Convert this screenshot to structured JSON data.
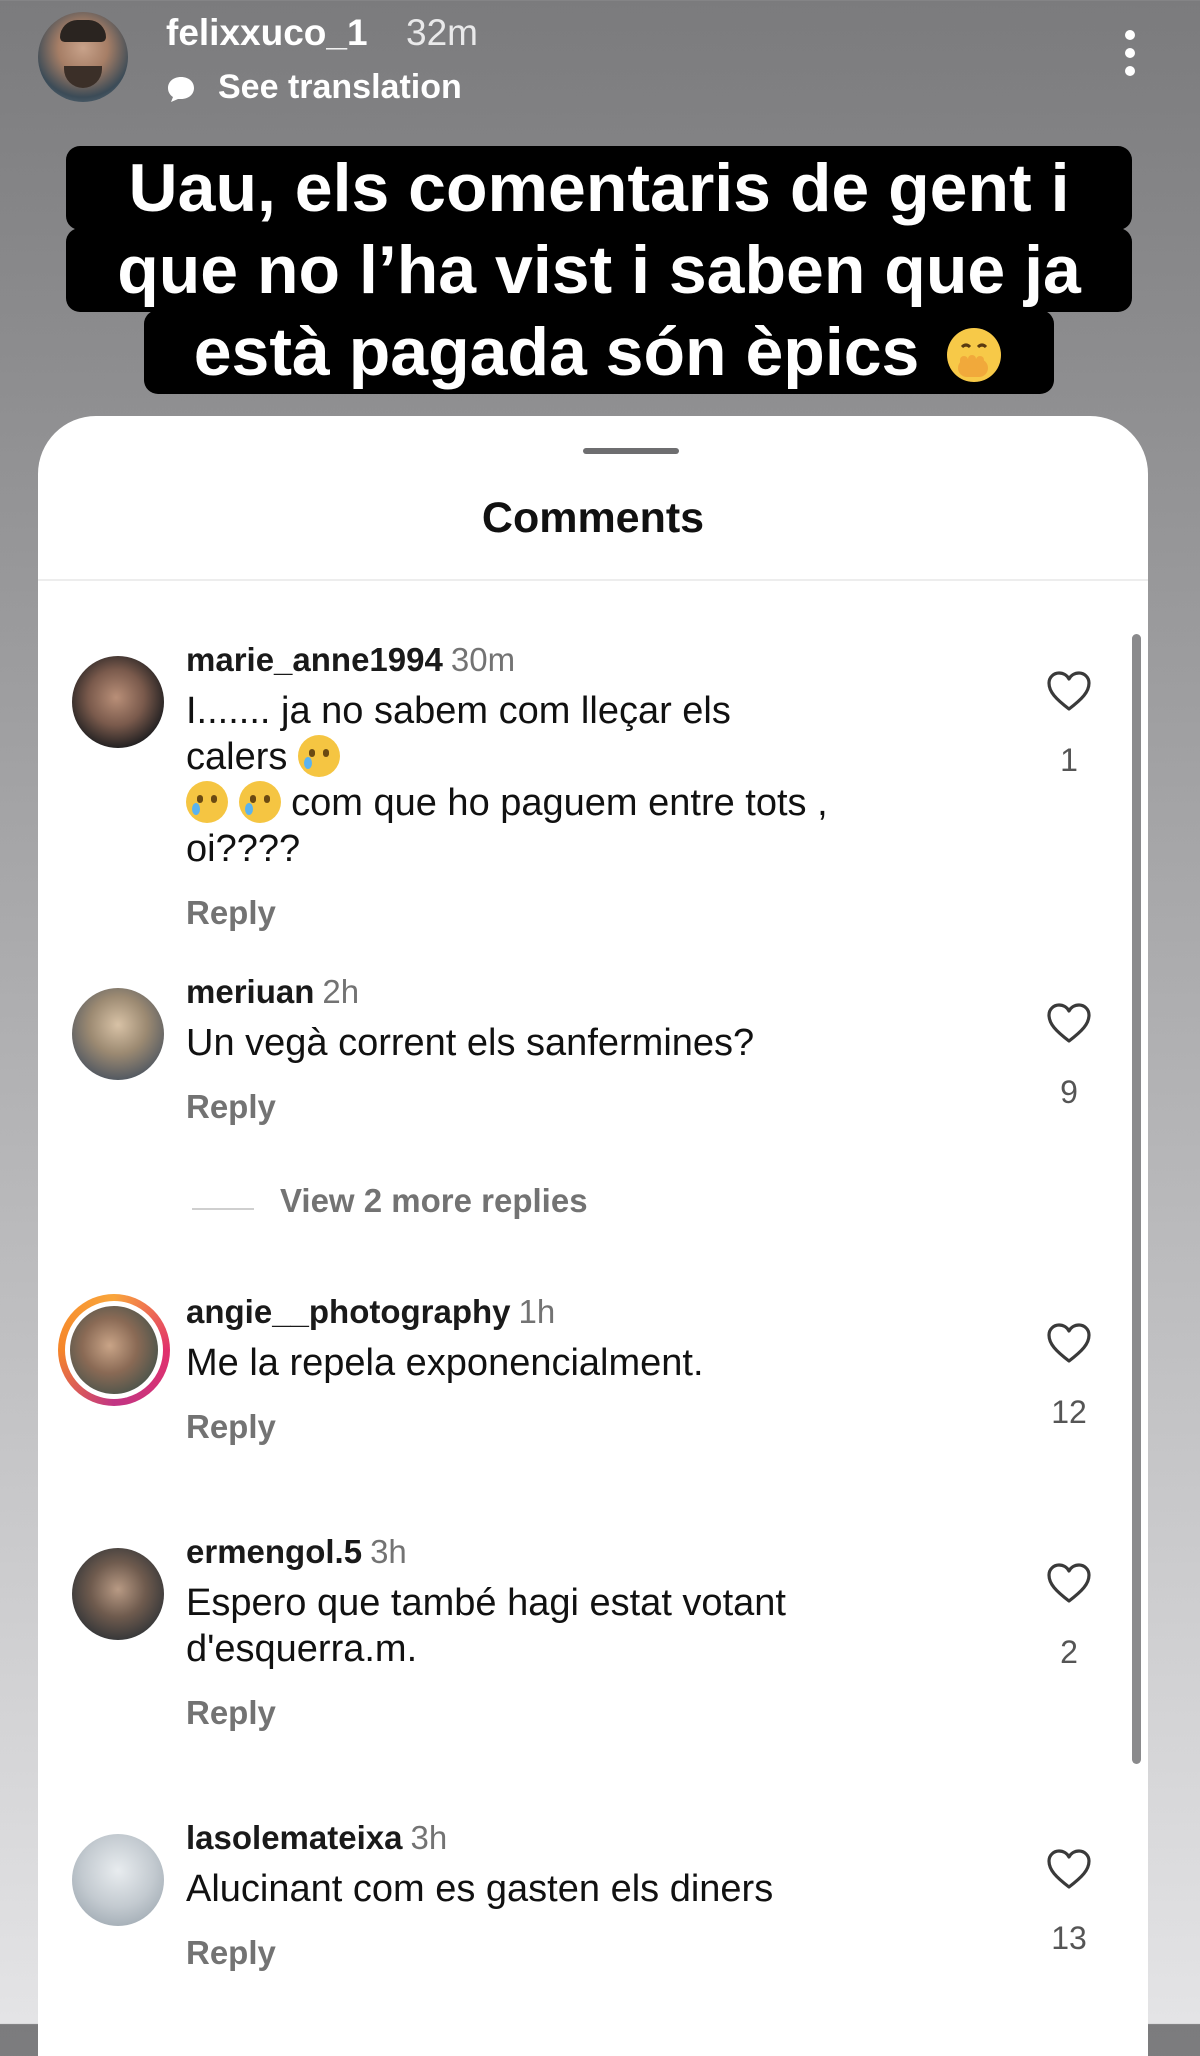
{
  "story": {
    "username": "felixxuco_1",
    "time": "32m",
    "translation_label": "See translation",
    "more_icon": "more-vertical-icon"
  },
  "caption": {
    "line1": "Uau, els comentaris de gent  i",
    "line2": "que no l’ha vist i saben que ja",
    "line3": "està pagada són èpics",
    "emoji": "face-with-hand-over-mouth"
  },
  "sheet": {
    "title": "Comments",
    "view_more_replies": "View 2 more replies"
  },
  "comments": [
    {
      "username": "marie_anne1994",
      "time": "30m",
      "text": "I....... ja no sabem com lleçar els calers",
      "text_line2": "com que ho paguem entre tots ,",
      "text_line3": "oi????",
      "reply_label": "Reply",
      "likes": "1"
    },
    {
      "username": "meriuan",
      "time": "2h",
      "text": "Un vegà corrent els sanfermines?",
      "reply_label": "Reply",
      "likes": "9"
    },
    {
      "username": "angie__photography",
      "time": "1h",
      "text": "Me la repela exponencialment.",
      "reply_label": "Reply",
      "likes": "12"
    },
    {
      "username": "ermengol.5",
      "time": "3h",
      "text": "Espero que també hagi estat votant",
      "text_line2": "d'esquerra.m.",
      "reply_label": "Reply",
      "likes": "2"
    },
    {
      "username": "lasolemateixa",
      "time": "3h",
      "text": "Alucinant com es gasten els diners",
      "reply_label": "Reply",
      "likes": "13"
    }
  ],
  "colors": {
    "caption_bg": "#000000",
    "sheet_bg": "#ffffff",
    "muted_text": "#737373"
  }
}
